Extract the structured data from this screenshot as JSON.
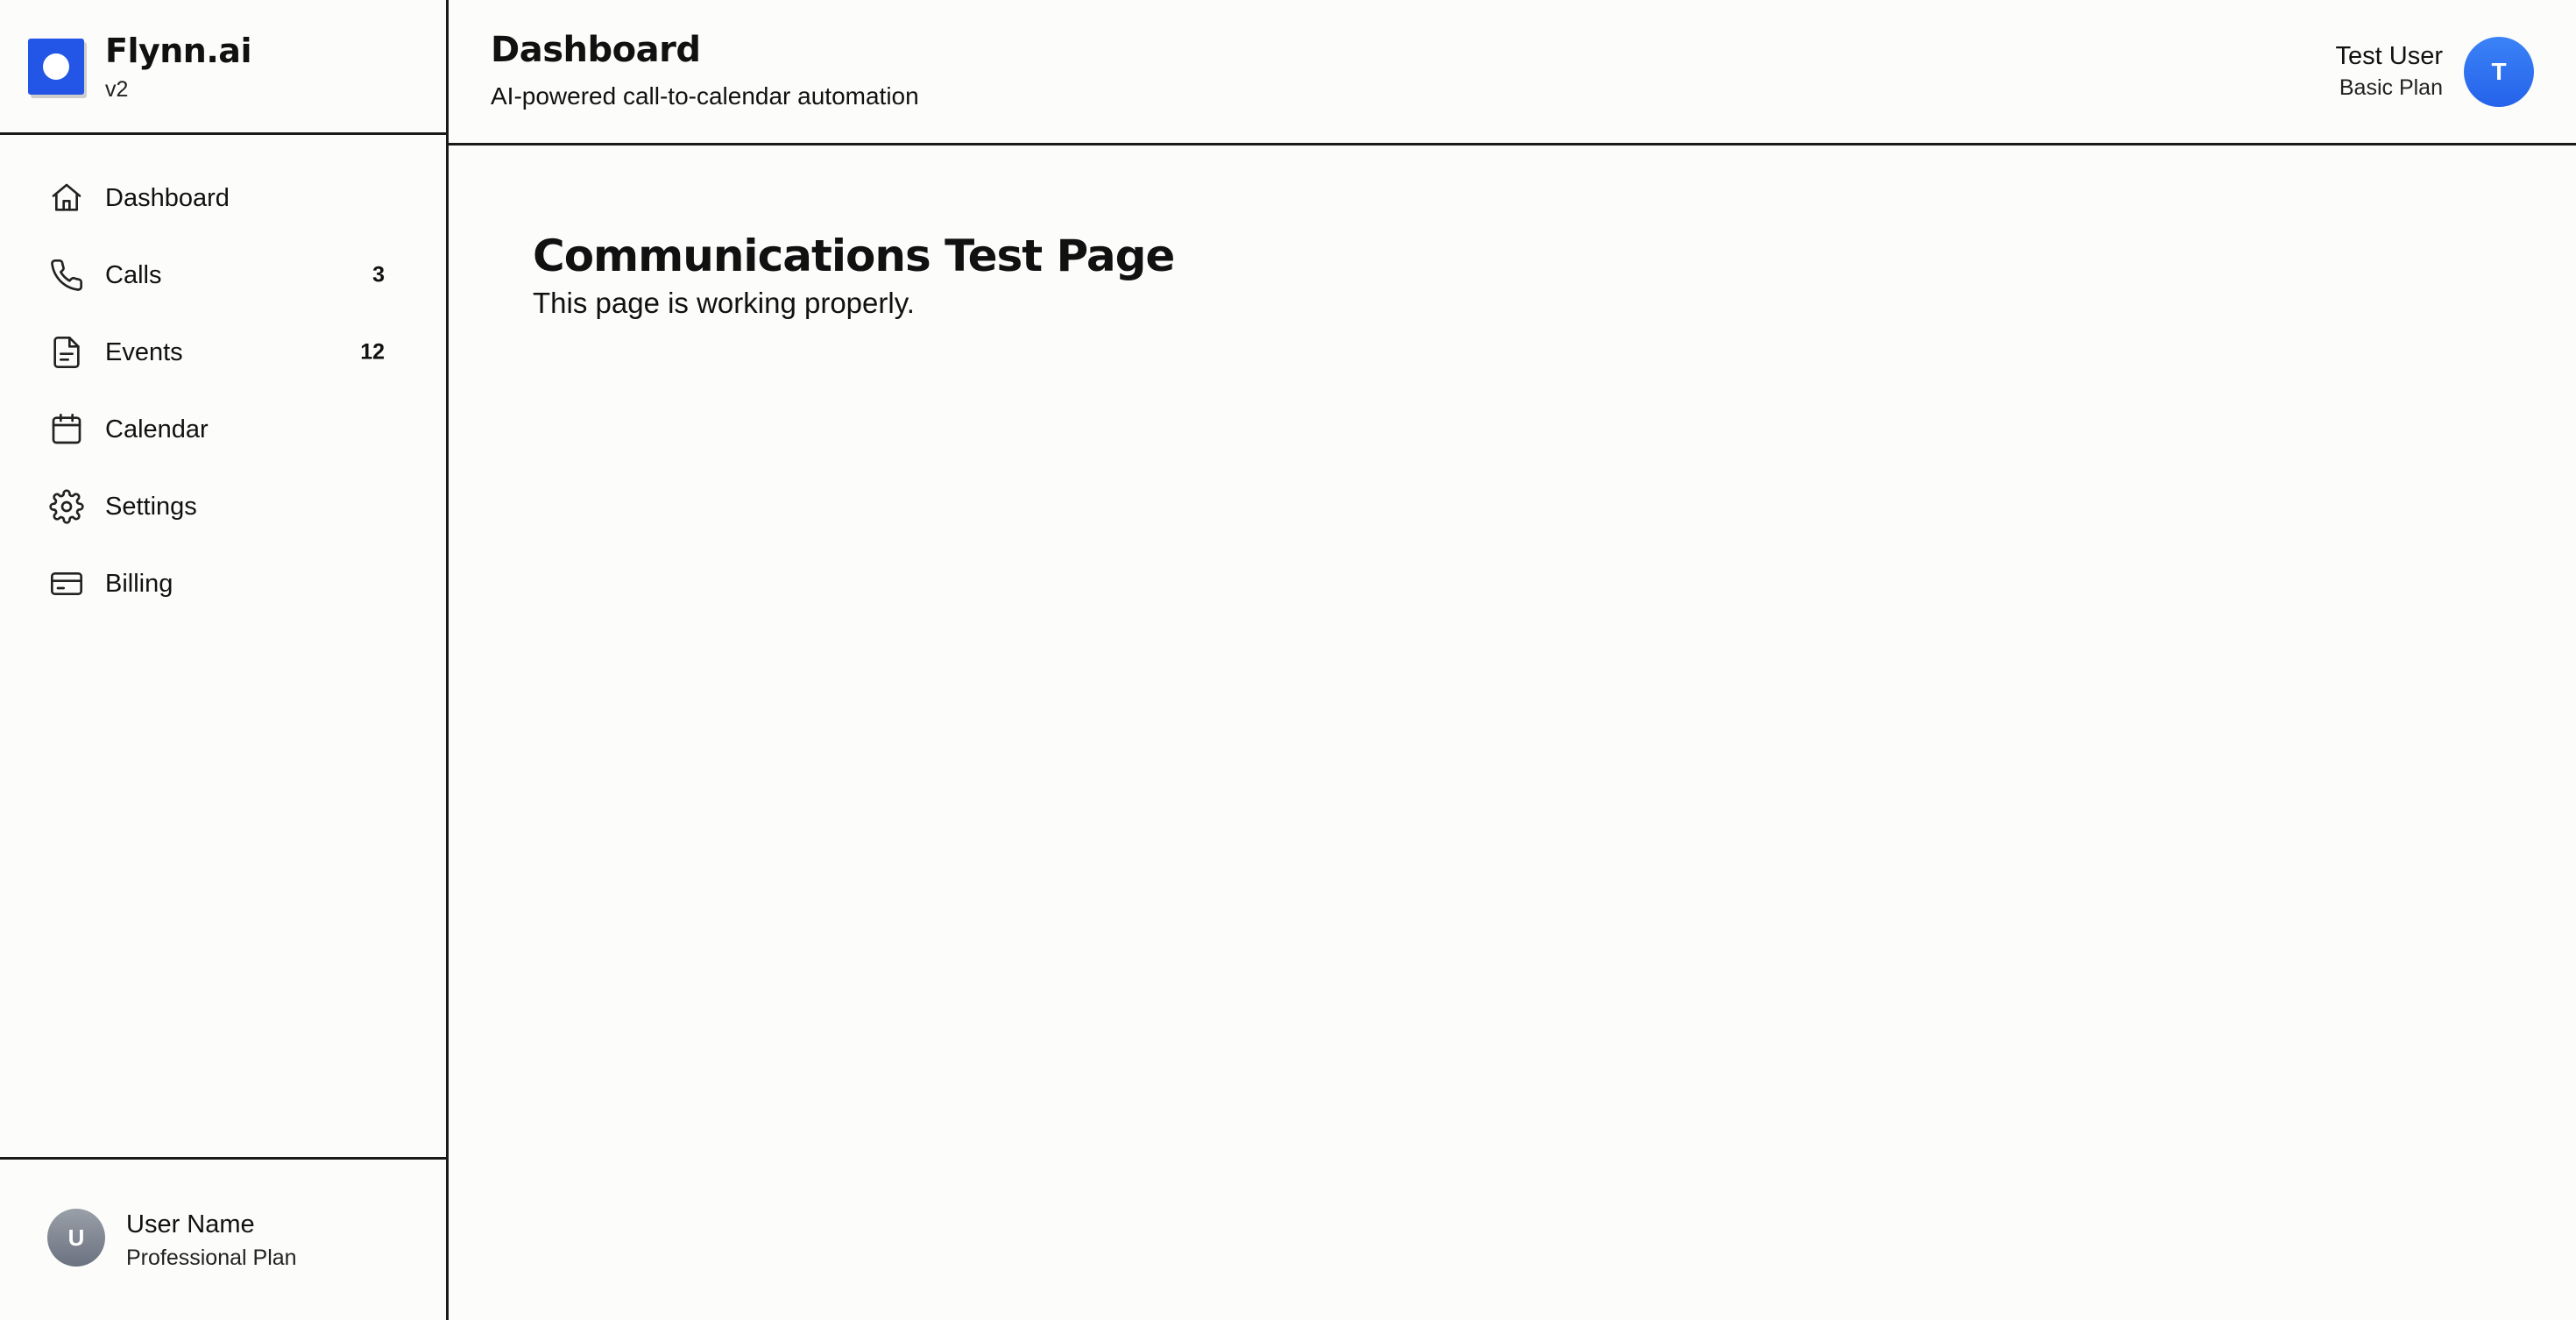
{
  "brand": {
    "name": "Flynn.ai",
    "version": "v2",
    "accent": "#2356e6"
  },
  "nav": {
    "items": [
      {
        "label": "Dashboard",
        "icon": "home-icon",
        "badge": ""
      },
      {
        "label": "Calls",
        "icon": "phone-icon",
        "badge": "3"
      },
      {
        "label": "Events",
        "icon": "document-icon",
        "badge": "12"
      },
      {
        "label": "Calendar",
        "icon": "calendar-icon",
        "badge": ""
      },
      {
        "label": "Settings",
        "icon": "gear-icon",
        "badge": ""
      },
      {
        "label": "Billing",
        "icon": "credit-card-icon",
        "badge": ""
      }
    ]
  },
  "sidebar_user": {
    "initial": "U",
    "name": "User Name",
    "plan": "Professional Plan"
  },
  "header": {
    "title": "Dashboard",
    "subtitle": "AI-powered call-to-calendar automation",
    "user": {
      "name": "Test User",
      "plan": "Basic Plan",
      "initial": "T",
      "avatar_color": "#2f6ef0"
    }
  },
  "main": {
    "title": "Communications Test Page",
    "text": "This page is working properly."
  }
}
